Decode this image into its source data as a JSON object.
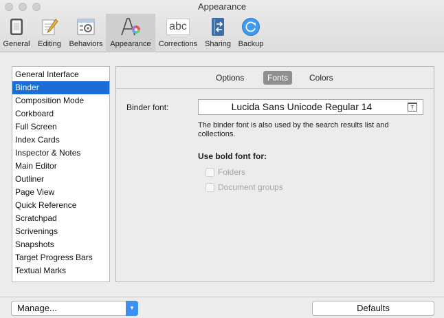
{
  "window": {
    "title": "Appearance"
  },
  "toolbar": {
    "items": [
      {
        "label": "General",
        "icon": "general-icon"
      },
      {
        "label": "Editing",
        "icon": "editing-icon"
      },
      {
        "label": "Behaviors",
        "icon": "behaviors-icon"
      },
      {
        "label": "Appearance",
        "icon": "appearance-icon",
        "active": true
      },
      {
        "label": "Corrections",
        "icon": "corrections-icon",
        "icon_text": "abc"
      },
      {
        "label": "Sharing",
        "icon": "sharing-icon"
      },
      {
        "label": "Backup",
        "icon": "backup-icon"
      }
    ]
  },
  "sidebar": {
    "selected": "Binder",
    "items": [
      {
        "label": "General Interface"
      },
      {
        "label": "Binder"
      },
      {
        "label": "Composition Mode"
      },
      {
        "label": "Corkboard"
      },
      {
        "label": "Full Screen"
      },
      {
        "label": "Index Cards"
      },
      {
        "label": "Inspector & Notes"
      },
      {
        "label": "Main Editor"
      },
      {
        "label": "Outliner"
      },
      {
        "label": "Page View"
      },
      {
        "label": "Quick Reference"
      },
      {
        "label": "Scratchpad"
      },
      {
        "label": "Scrivenings"
      },
      {
        "label": "Snapshots"
      },
      {
        "label": "Target Progress Bars"
      },
      {
        "label": "Textual Marks"
      }
    ]
  },
  "tabs": {
    "options": "Options",
    "fonts": "Fonts",
    "colors": "Colors",
    "active": "Fonts"
  },
  "fonts": {
    "binder_font_label": "Binder font:",
    "binder_font_value": "Lucida Sans Unicode Regular 14",
    "font_picker_icon_text": "T",
    "help_text": "The binder font is also used by the search results list and collections.",
    "bold_heading": "Use bold font for:",
    "checkboxes": [
      {
        "label": "Folders",
        "checked": false,
        "enabled": false
      },
      {
        "label": "Document groups",
        "checked": false,
        "enabled": false
      }
    ]
  },
  "bottom": {
    "manage_label": "Manage...",
    "defaults_label": "Defaults"
  },
  "colors": {
    "selection": "#1c6ed6",
    "active_tab": "#8f8f8f",
    "popup_arrow": "#3d8ff0"
  }
}
